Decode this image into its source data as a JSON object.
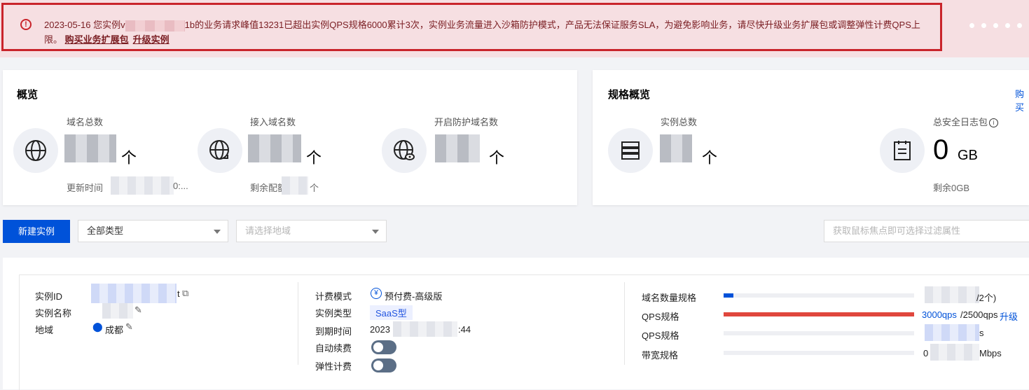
{
  "alert": {
    "date_prefix": "2023-05-16 您实例",
    "id_start": "v",
    "message": "1b的业务请求峰值13231已超出实例QPS规格6000累计3次，实例业务流量进入沙箱防护模式，产品无法保证服务SLA，为避免影响业务，请尽快升级业务扩展包或调整弹性计费QPS上限。",
    "buy_link": "购买业务扩展包",
    "upgrade_link": "升级实例",
    "icon": "alert-circle-icon"
  },
  "overview": {
    "title": "概览",
    "total_domains_label": "域名总数",
    "connected_domains_label": "接入域名数",
    "protected_domains_label": "开启防护域名数",
    "unit": "个",
    "update_time_label": "更新时间",
    "update_time_tail": "0:...",
    "remaining_label": "剩余配额",
    "remaining_unit": "个"
  },
  "spec_overview": {
    "title": "规格概览",
    "buy_link": "购买",
    "instances_label": "实例总数",
    "instances_unit": "个",
    "log_label": "总安全日志包",
    "log_value": "0",
    "log_unit": "GB",
    "log_remaining": "剩余0GB"
  },
  "toolbar": {
    "new_instance": "新建实例",
    "type_select": "全部类型",
    "region_placeholder": "请选择地域",
    "filter_placeholder": "获取鼠标焦点即可选择过滤属性"
  },
  "instance": {
    "id_label": "实例ID",
    "id_tail": "t",
    "name_label": "实例名称",
    "region_label": "地域",
    "region_value": "成都",
    "billing_label": "计费模式",
    "billing_value": "预付费-高级版",
    "type_label": "实例类型",
    "type_value": "SaaS型",
    "expire_label": "到期时间",
    "expire_head": "2023",
    "expire_tail": ":44",
    "auto_renew_label": "自动续费",
    "elastic_label": "弹性计费",
    "domain_spec_label": "域名数量规格",
    "domain_spec_tail": "/2个)",
    "qps_spec_label": "QPS规格",
    "qps_value": "3000qps",
    "qps_limit": "/2500qps",
    "upgrade": "升级",
    "qps_spec_label2": "QPS规格",
    "qps2_tail": "s",
    "bandwidth_label": "带宽规格",
    "bandwidth_head": "0",
    "bandwidth_tail": "Mbps",
    "domain_fill": 0.05,
    "qps_fill": 1.0
  },
  "colors": {
    "primary": "#0052d9",
    "danger": "#c9242b",
    "qps_bar": "#e0473d"
  }
}
